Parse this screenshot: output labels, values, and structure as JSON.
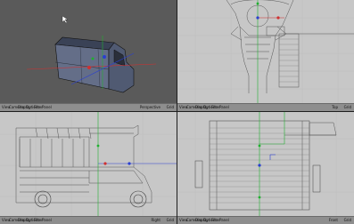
{
  "viewports": {
    "perspective": {
      "label": "Perspective",
      "grid": "Grid"
    },
    "top": {
      "label": "Top",
      "grid": "Grid"
    },
    "right": {
      "label": "Right",
      "grid": "Grid"
    },
    "front": {
      "label": "Front",
      "grid": "Grid"
    }
  },
  "viewport_menu": {
    "view": "View",
    "cameras": "Cameras",
    "display": "Display",
    "options": "Options",
    "filter": "Filter",
    "panel": "Panel"
  },
  "colors": {
    "axis_x": "#d03030",
    "axis_y": "#20b030",
    "axis_z": "#2a3fd0",
    "wire": "#555555",
    "bg_dark": "#5a5a5a",
    "bg_light": "#c7c7c7"
  }
}
